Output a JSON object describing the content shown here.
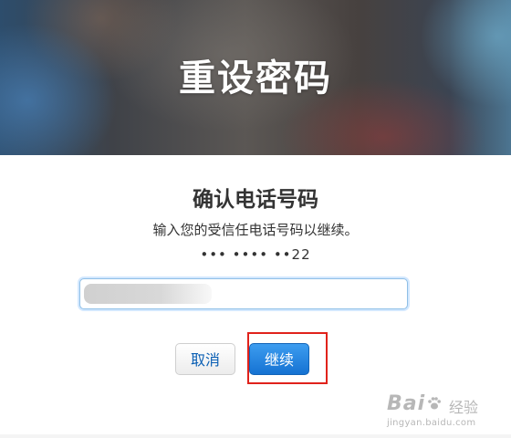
{
  "hero": {
    "title": "重设密码"
  },
  "form": {
    "title": "确认电话号码",
    "instruction": "输入您的受信任电话号码以继续。",
    "masked_phone": "••• •••• ••22",
    "phone_input": {
      "value": "",
      "placeholder": ""
    }
  },
  "buttons": {
    "cancel_label": "取消",
    "continue_label": "继续"
  },
  "watermark": {
    "brand": "Bai",
    "brand_cn": "经验",
    "url": "jingyan.baidu.com"
  },
  "colors": {
    "accent": "#1572d2",
    "highlight": "#e0221b",
    "cancel_text": "#0a5fb4"
  }
}
